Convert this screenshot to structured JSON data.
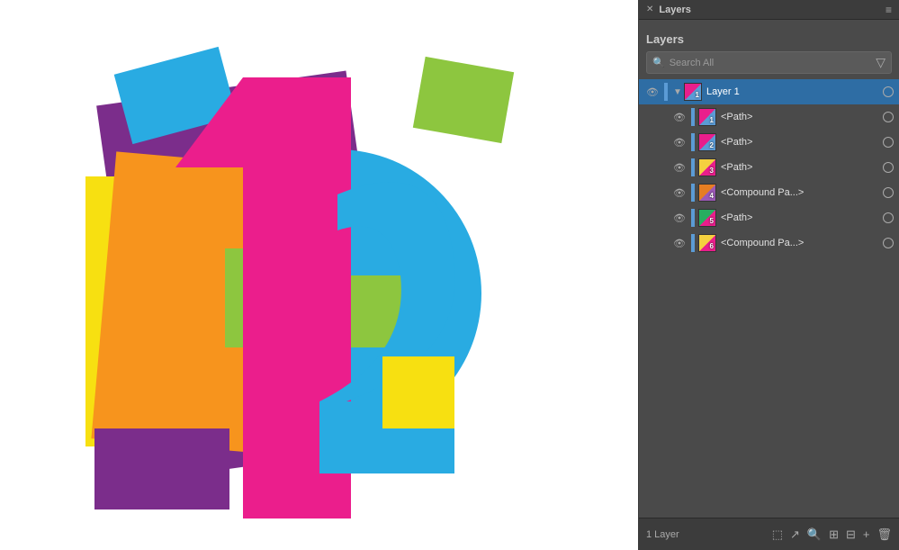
{
  "panel": {
    "title": "Layers",
    "search_placeholder": "Search All",
    "filter_icon": "▼",
    "footer_text": "1 Layer",
    "layer_1": {
      "name": "Layer 1",
      "type": "layer",
      "expanded": true
    },
    "items": [
      {
        "id": "1",
        "name": "<Path>",
        "type": "path",
        "num": "1"
      },
      {
        "id": "2",
        "name": "<Path>",
        "type": "path",
        "num": "2"
      },
      {
        "id": "3",
        "name": "<Path>",
        "type": "path",
        "num": "3"
      },
      {
        "id": "4",
        "name": "<Compound Pa...",
        "type": "compound",
        "num": "4"
      },
      {
        "id": "5",
        "name": "<Path>",
        "type": "path",
        "num": "5"
      },
      {
        "id": "6",
        "name": "<Compound Pa...",
        "type": "compound",
        "num": "6"
      }
    ]
  }
}
